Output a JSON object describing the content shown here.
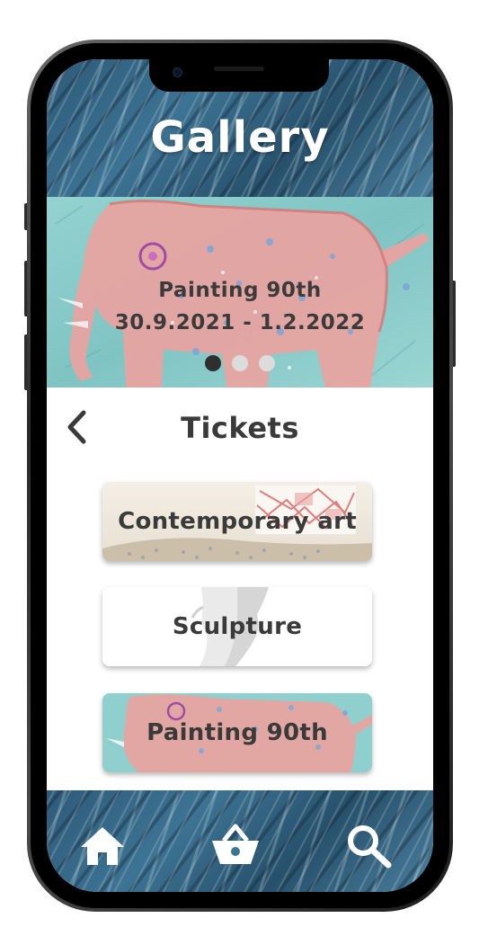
{
  "app": {
    "title": "Gallery"
  },
  "hero": {
    "exhibition_name": "Painting 90th",
    "dates": "30.9.2021 - 1.2.2022",
    "slides": 3,
    "active_slide": 1
  },
  "tickets": {
    "title": "Tickets",
    "categories": [
      {
        "label": "Contemporary art"
      },
      {
        "label": "Sculpture"
      },
      {
        "label": "Painting 90th"
      }
    ]
  },
  "nav": {
    "items": [
      {
        "icon": "home-icon"
      },
      {
        "icon": "basket-icon"
      },
      {
        "icon": "search-icon"
      }
    ]
  },
  "colors": {
    "paint_blue": "#3d7393",
    "hero_teal": "#8ccfcc",
    "elephant_pink": "#e9a3a0",
    "text_dark": "#3a3a3a",
    "dot_active": "#2f2f2f",
    "dot_inactive": "#dcdcdc"
  }
}
